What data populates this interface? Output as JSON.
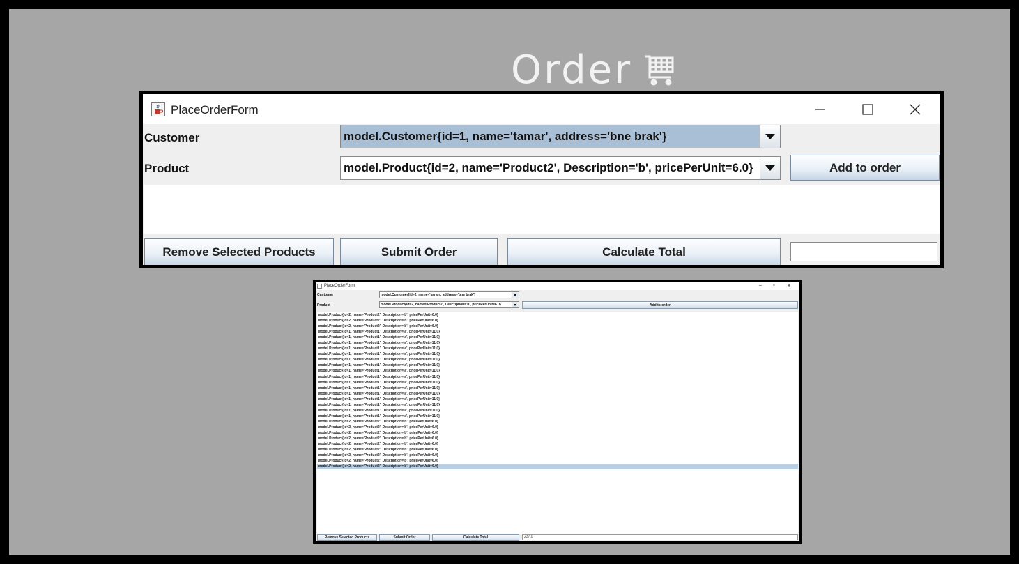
{
  "heading": {
    "title": "Order"
  },
  "main_window": {
    "title": "PlaceOrderForm",
    "customer_label": "Customer",
    "customer_value": "model.Customer{id=1, name='tamar', address='bne brak'}",
    "product_label": "Product",
    "product_value": "model.Product{id=2, name='Product2', Description='b', pricePerUnit=6.0}",
    "add_button": "Add to order",
    "remove_button": "Remove Selected Products",
    "submit_button": "Submit Order",
    "calc_button": "Calculate Total",
    "total_value": ""
  },
  "second_window": {
    "title": "PlaceOrderForm",
    "customer_label": "Customer",
    "customer_value": "model.Customer{id=2, name='sarah', address='bne brak'}",
    "product_label": "Product",
    "product_value": "model.Product{id=2, name='Product2', Description='b', pricePerUnit=6.0}",
    "add_button": "Add to order",
    "remove_button": "Remove Selected Products",
    "submit_button": "Submit Order",
    "calc_button": "Calculate Total",
    "total_value": "237.0",
    "list_items": [
      "model.Product{id=2, name='Product2', Description='b', pricePerUnit=6.0}",
      "model.Product{id=2, name='Product2', Description='b', pricePerUnit=6.0}",
      "model.Product{id=2, name='Product2', Description='b', pricePerUnit=6.0}",
      "model.Product{id=1, name='Product1', Description='a', pricePerUnit=11.0}",
      "model.Product{id=1, name='Product1', Description='a', pricePerUnit=11.0}",
      "model.Product{id=1, name='Product1', Description='a', pricePerUnit=11.0}",
      "model.Product{id=1, name='Product1', Description='a', pricePerUnit=11.0}",
      "model.Product{id=1, name='Product1', Description='a', pricePerUnit=11.0}",
      "model.Product{id=1, name='Product1', Description='a', pricePerUnit=11.0}",
      "model.Product{id=1, name='Product1', Description='a', pricePerUnit=11.0}",
      "model.Product{id=1, name='Product1', Description='a', pricePerUnit=11.0}",
      "model.Product{id=1, name='Product1', Description='a', pricePerUnit=11.0}",
      "model.Product{id=1, name='Product1', Description='a', pricePerUnit=11.0}",
      "model.Product{id=1, name='Product1', Description='a', pricePerUnit=11.0}",
      "model.Product{id=1, name='Product1', Description='a', pricePerUnit=11.0}",
      "model.Product{id=1, name='Product1', Description='a', pricePerUnit=11.0}",
      "model.Product{id=1, name='Product1', Description='a', pricePerUnit=11.0}",
      "model.Product{id=1, name='Product1', Description='a', pricePerUnit=11.0}",
      "model.Product{id=1, name='Product1', Description='a', pricePerUnit=11.0}",
      "model.Product{id=2, name='Product2', Description='b', pricePerUnit=6.0}",
      "model.Product{id=2, name='Product2', Description='b', pricePerUnit=6.0}",
      "model.Product{id=2, name='Product2', Description='b', pricePerUnit=6.0}",
      "model.Product{id=2, name='Product2', Description='b', pricePerUnit=6.0}",
      "model.Product{id=2, name='Product2', Description='b', pricePerUnit=6.0}",
      "model.Product{id=2, name='Product2', Description='b', pricePerUnit=6.0}",
      "model.Product{id=2, name='Product2', Description='b', pricePerUnit=6.0}",
      "model.Product{id=2, name='Product2', Description='b', pricePerUnit=6.0}",
      "model.Product{id=2, name='Product2', Description='b', pricePerUnit=6.0}"
    ]
  },
  "icons": {
    "cart": "shopping-cart-icon",
    "app": "java-cup-icon",
    "minimize": "minimize-icon",
    "maximize": "maximize-icon",
    "close": "close-icon"
  },
  "colors": {
    "slide_bg": "#a6a6a6",
    "selection": "#b8cfe5"
  }
}
